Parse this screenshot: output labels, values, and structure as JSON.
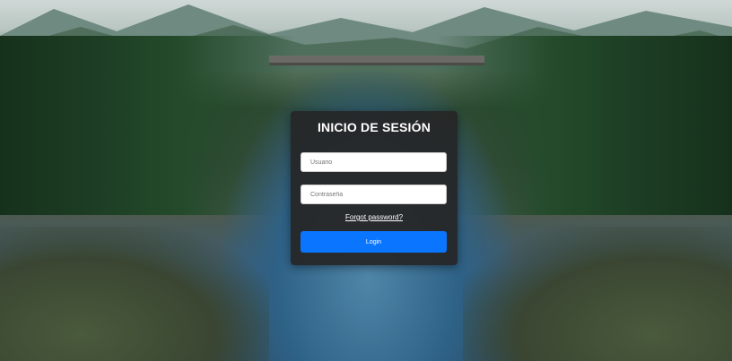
{
  "login": {
    "title": "INICIO DE SESIÓN",
    "username_placeholder": "Usuario",
    "password_placeholder": "Contraseña",
    "forgot_label": "Forgot password?",
    "login_label": "Login"
  },
  "colors": {
    "card_background": "#262626",
    "button_primary": "#0a75ff",
    "text_light": "#ffffff"
  }
}
